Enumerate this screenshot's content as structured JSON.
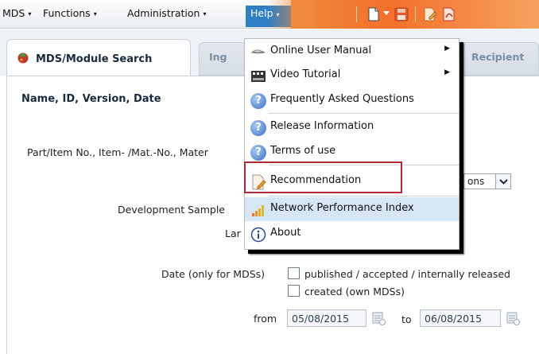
{
  "menubar": {
    "items": [
      "MDS",
      "Functions",
      "Administration"
    ],
    "active": "Help",
    "caret": "▾"
  },
  "tabs": {
    "active": "MDS/Module Search",
    "inactive": [
      "Ing",
      "Recipient"
    ]
  },
  "form": {
    "section_title": "Name, ID, Version, Date",
    "part_label": "Part/Item No., Item- /Mat.-No., Mater",
    "dev_sample_label": "Development Sample",
    "lang_label": "Lar",
    "combo_value": "ons",
    "date_label": "Date (only for MDSs)",
    "option_published": "published / accepted / internally released",
    "option_created": "created (own MDSs)",
    "from_label": "from",
    "from_value": "05/08/2015",
    "to_label": "to",
    "to_value": "06/08/2015"
  },
  "help_menu": {
    "items": [
      {
        "label": "Online User Manual",
        "icon": "book-icon",
        "submenu": true
      },
      {
        "label": "Video Tutorial",
        "icon": "film-icon",
        "submenu": true
      },
      {
        "label": "Frequently Asked Questions",
        "icon": "question-icon",
        "submenu": false
      },
      {
        "label": "Release Information",
        "icon": "question-icon",
        "submenu": false
      },
      {
        "label": "Terms of use",
        "icon": "question-icon",
        "submenu": false
      },
      {
        "label": "Recommendation",
        "icon": "document-edit-icon",
        "submenu": false
      },
      {
        "label": "Network Performance Index",
        "icon": "signal-bars-icon",
        "submenu": false
      },
      {
        "label": "About",
        "icon": "info-icon",
        "submenu": false
      }
    ],
    "highlighted": "Recommendation",
    "hovered": "Network Performance Index"
  },
  "colors": {
    "help_active_bg": "#2f7fc4",
    "toolbar_orange": "#f3702b",
    "highlight_border": "#b12a33",
    "hover_bg": "#d6e6f5"
  }
}
